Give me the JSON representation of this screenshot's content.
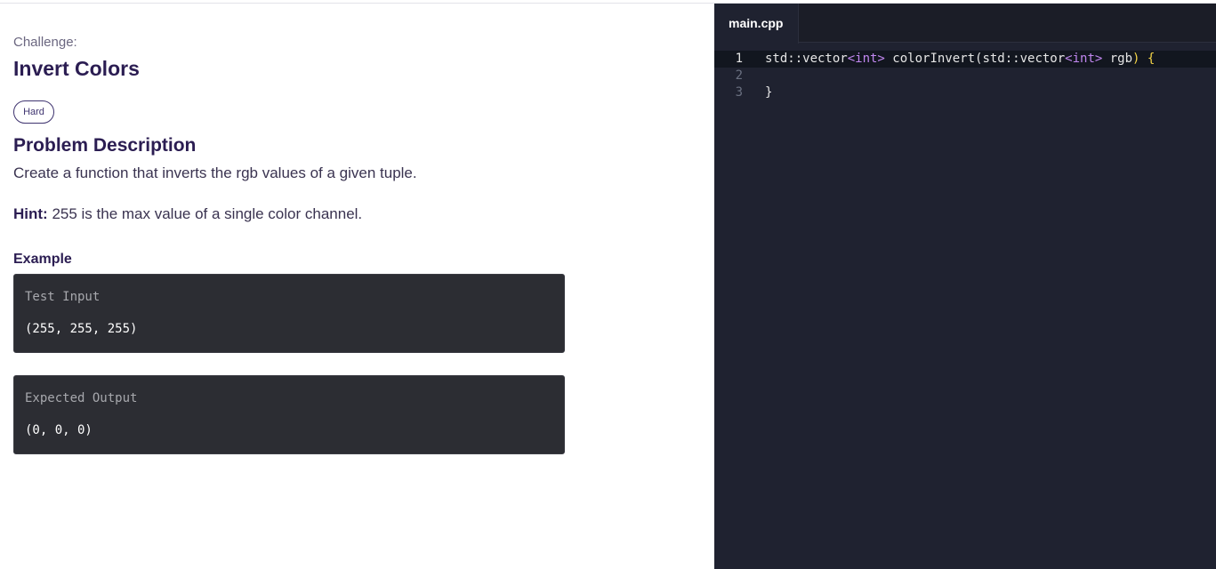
{
  "challenge": {
    "label": "Challenge:",
    "title": "Invert Colors",
    "difficulty": "Hard"
  },
  "problem": {
    "heading": "Problem Description",
    "description": "Create a function that inverts the rgb values of a given tuple.",
    "hint_label": "Hint:",
    "hint_text": " 255 is the max value of a single color channel."
  },
  "example": {
    "heading": "Example",
    "input_label": "Test Input",
    "input_value": "(255, 255, 255)",
    "output_label": "Expected Output",
    "output_value": "(0, 0, 0)"
  },
  "editor": {
    "tab_name": "main.cpp",
    "lines": [
      {
        "num": "1",
        "t1": "std::vector",
        "t2": "<int>",
        "t3": " colorInvert(std::vector",
        "t4": "<int>",
        "t5": " rgb",
        "t6": ")",
        "t7": " {"
      },
      {
        "num": "2"
      },
      {
        "num": "3",
        "close": "}"
      }
    ]
  },
  "colors": {
    "heading": "#2b1d52",
    "editor_bg": "#1f2230",
    "keyword": "#c187f0",
    "bracket": "#f5d547",
    "example_box": "#2c2d33"
  }
}
